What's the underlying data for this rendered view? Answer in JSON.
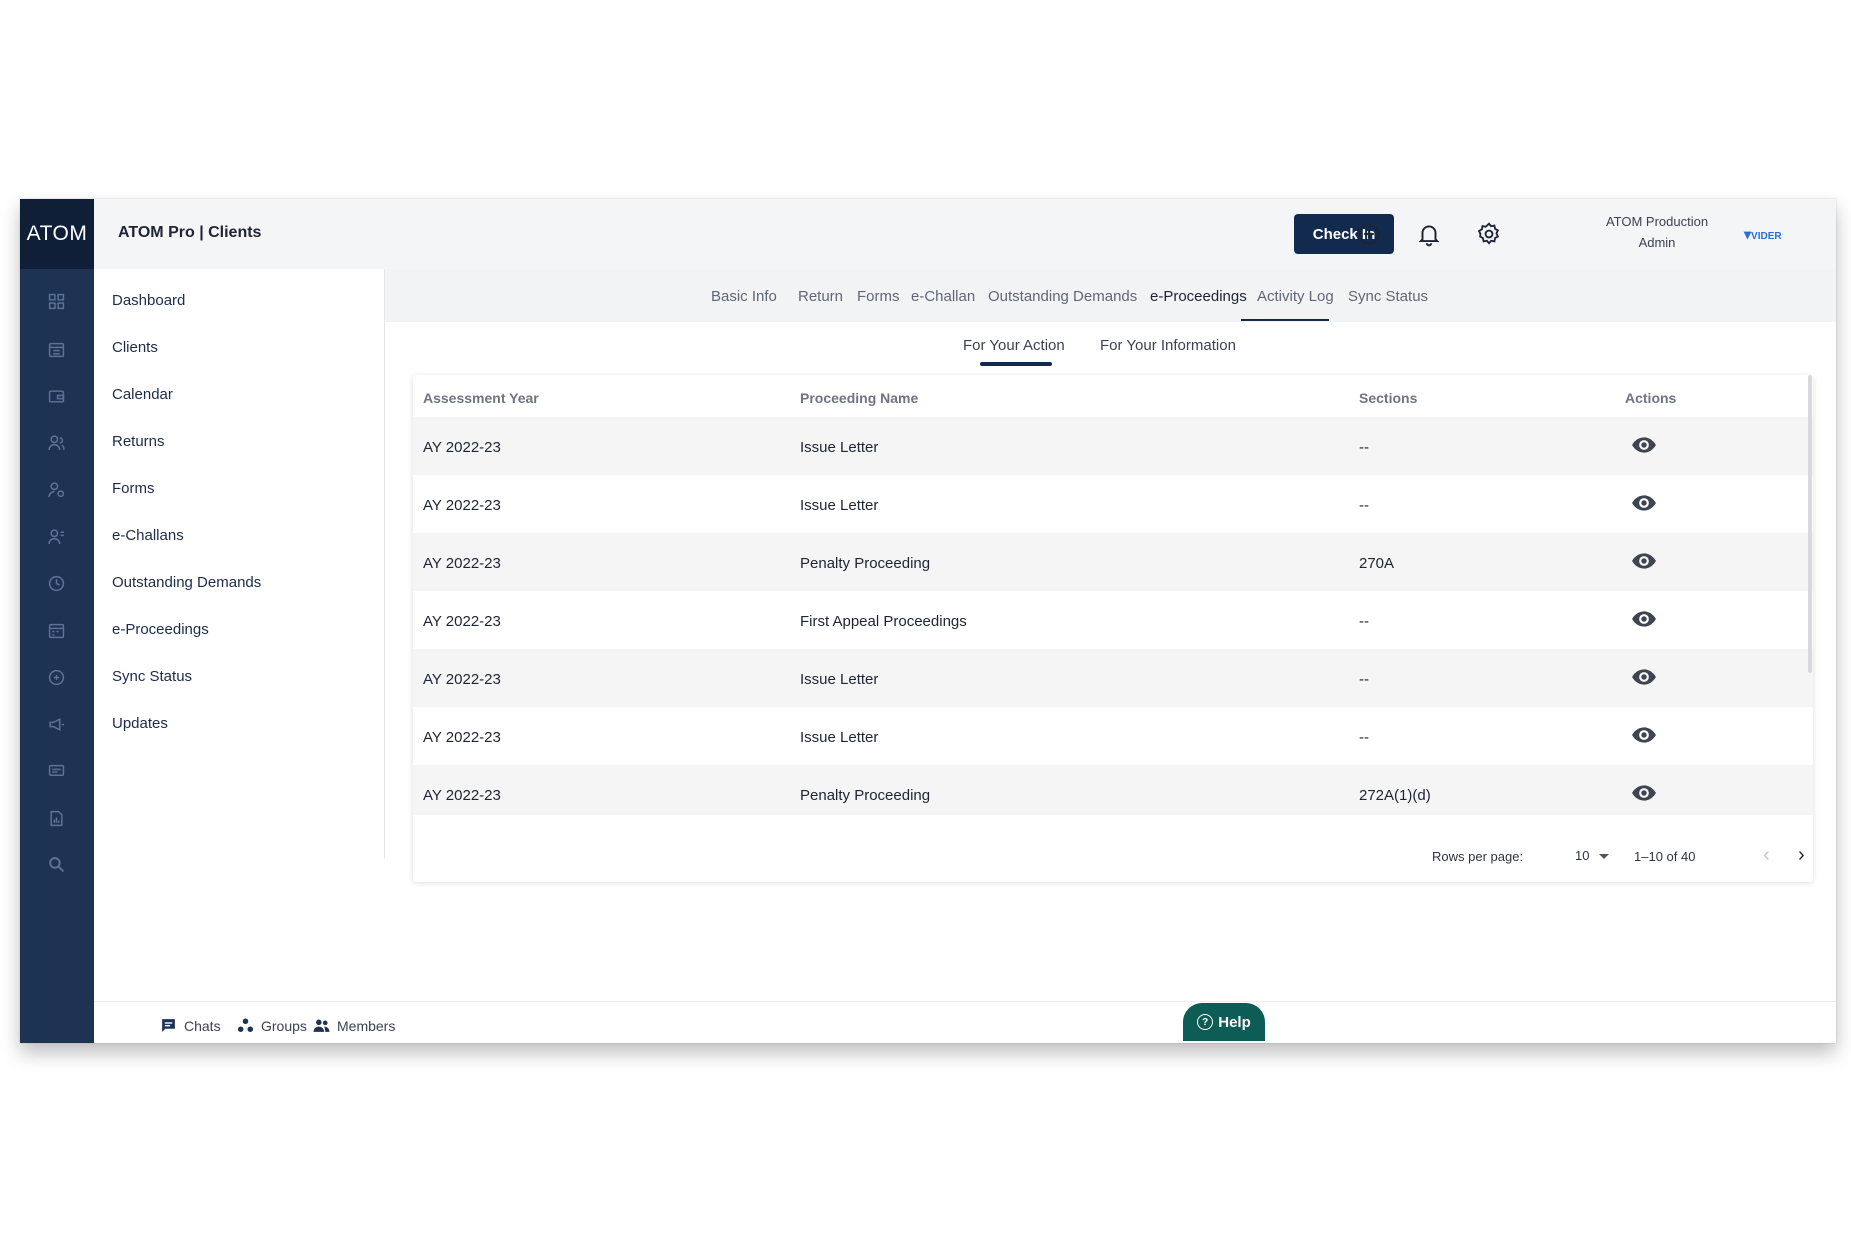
{
  "rail": {
    "logo": "ATOM"
  },
  "header": {
    "title": "ATOM Pro | Clients",
    "checkin_label": "Check In",
    "user_name": "ATOM Production",
    "user_role": "Admin",
    "brand": "VIDER"
  },
  "sidebar": {
    "items": [
      {
        "label": "Dashboard"
      },
      {
        "label": "Clients"
      },
      {
        "label": "Calendar"
      },
      {
        "label": "Returns"
      },
      {
        "label": "Forms"
      },
      {
        "label": "e-Challans"
      },
      {
        "label": "Outstanding Demands"
      },
      {
        "label": "e-Proceedings"
      },
      {
        "label": "Sync Status"
      },
      {
        "label": "Updates"
      }
    ]
  },
  "tabs": [
    {
      "label": "Basic Info"
    },
    {
      "label": "Return"
    },
    {
      "label": "Forms"
    },
    {
      "label": "e-Challan"
    },
    {
      "label": "Outstanding Demands"
    },
    {
      "label": "e-Proceedings",
      "active": true
    },
    {
      "label": "Activity Log"
    },
    {
      "label": "Sync Status"
    }
  ],
  "subtabs": [
    {
      "label": "For Your Action",
      "active": true
    },
    {
      "label": "For Your Information"
    }
  ],
  "table": {
    "columns": [
      "Assessment Year",
      "Proceeding Name",
      "Sections",
      "Actions"
    ],
    "rows": [
      {
        "year": "AY 2022-23",
        "name": "Issue Letter",
        "section": "--"
      },
      {
        "year": "AY 2022-23",
        "name": "Issue Letter",
        "section": "--"
      },
      {
        "year": "AY 2022-23",
        "name": "Penalty Proceeding",
        "section": "270A"
      },
      {
        "year": "AY 2022-23",
        "name": "First Appeal Proceedings",
        "section": "--"
      },
      {
        "year": "AY 2022-23",
        "name": "Issue Letter",
        "section": "--"
      },
      {
        "year": "AY 2022-23",
        "name": "Issue Letter",
        "section": "--"
      },
      {
        "year": "AY 2022-23",
        "name": "Penalty Proceeding",
        "section": "272A(1)(d)"
      }
    ],
    "rows_per_page_label": "Rows per page:",
    "rows_per_page": "10",
    "range": "1–10 of 40"
  },
  "bottom": {
    "chats": "Chats",
    "groups": "Groups",
    "members": "Members",
    "help": "Help"
  }
}
